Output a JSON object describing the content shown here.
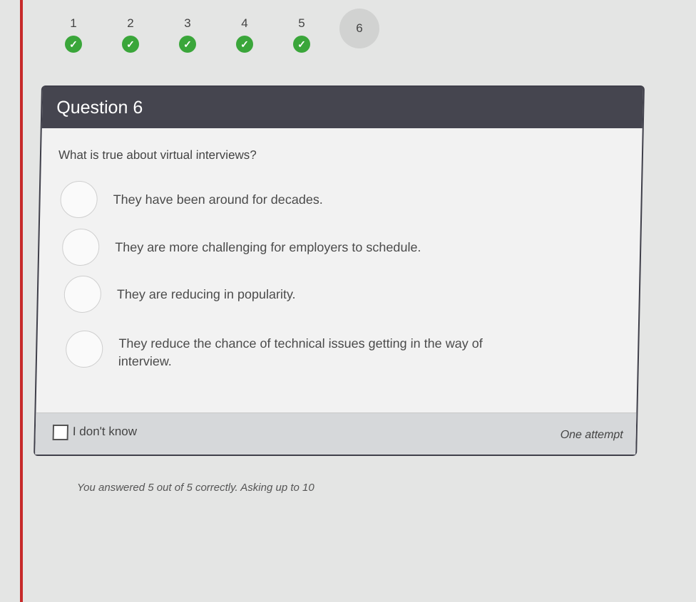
{
  "stepper": {
    "steps": [
      {
        "number": "1",
        "status": "correct"
      },
      {
        "number": "2",
        "status": "correct"
      },
      {
        "number": "3",
        "status": "correct"
      },
      {
        "number": "4",
        "status": "correct"
      },
      {
        "number": "5",
        "status": "correct"
      },
      {
        "number": "6",
        "status": "current"
      }
    ],
    "check_glyph": "✓",
    "check_color": "#3aa63a"
  },
  "question": {
    "title": "Question 6",
    "prompt": "What is true about virtual interviews?",
    "options": [
      {
        "label": "They have been around for decades."
      },
      {
        "label": "They are more challenging for employers to schedule."
      },
      {
        "label": "They are reducing in popularity."
      },
      {
        "label": "They reduce the chance of technical issues getting in the way of interview."
      }
    ]
  },
  "footer": {
    "dont_know_label": "I don't know",
    "attempts_label": "One attempt"
  },
  "summary": "You answered 5 out of 5 correctly. Asking up to 10",
  "colors": {
    "header_bg": "#45454f",
    "accent_red": "#c72a2a"
  }
}
